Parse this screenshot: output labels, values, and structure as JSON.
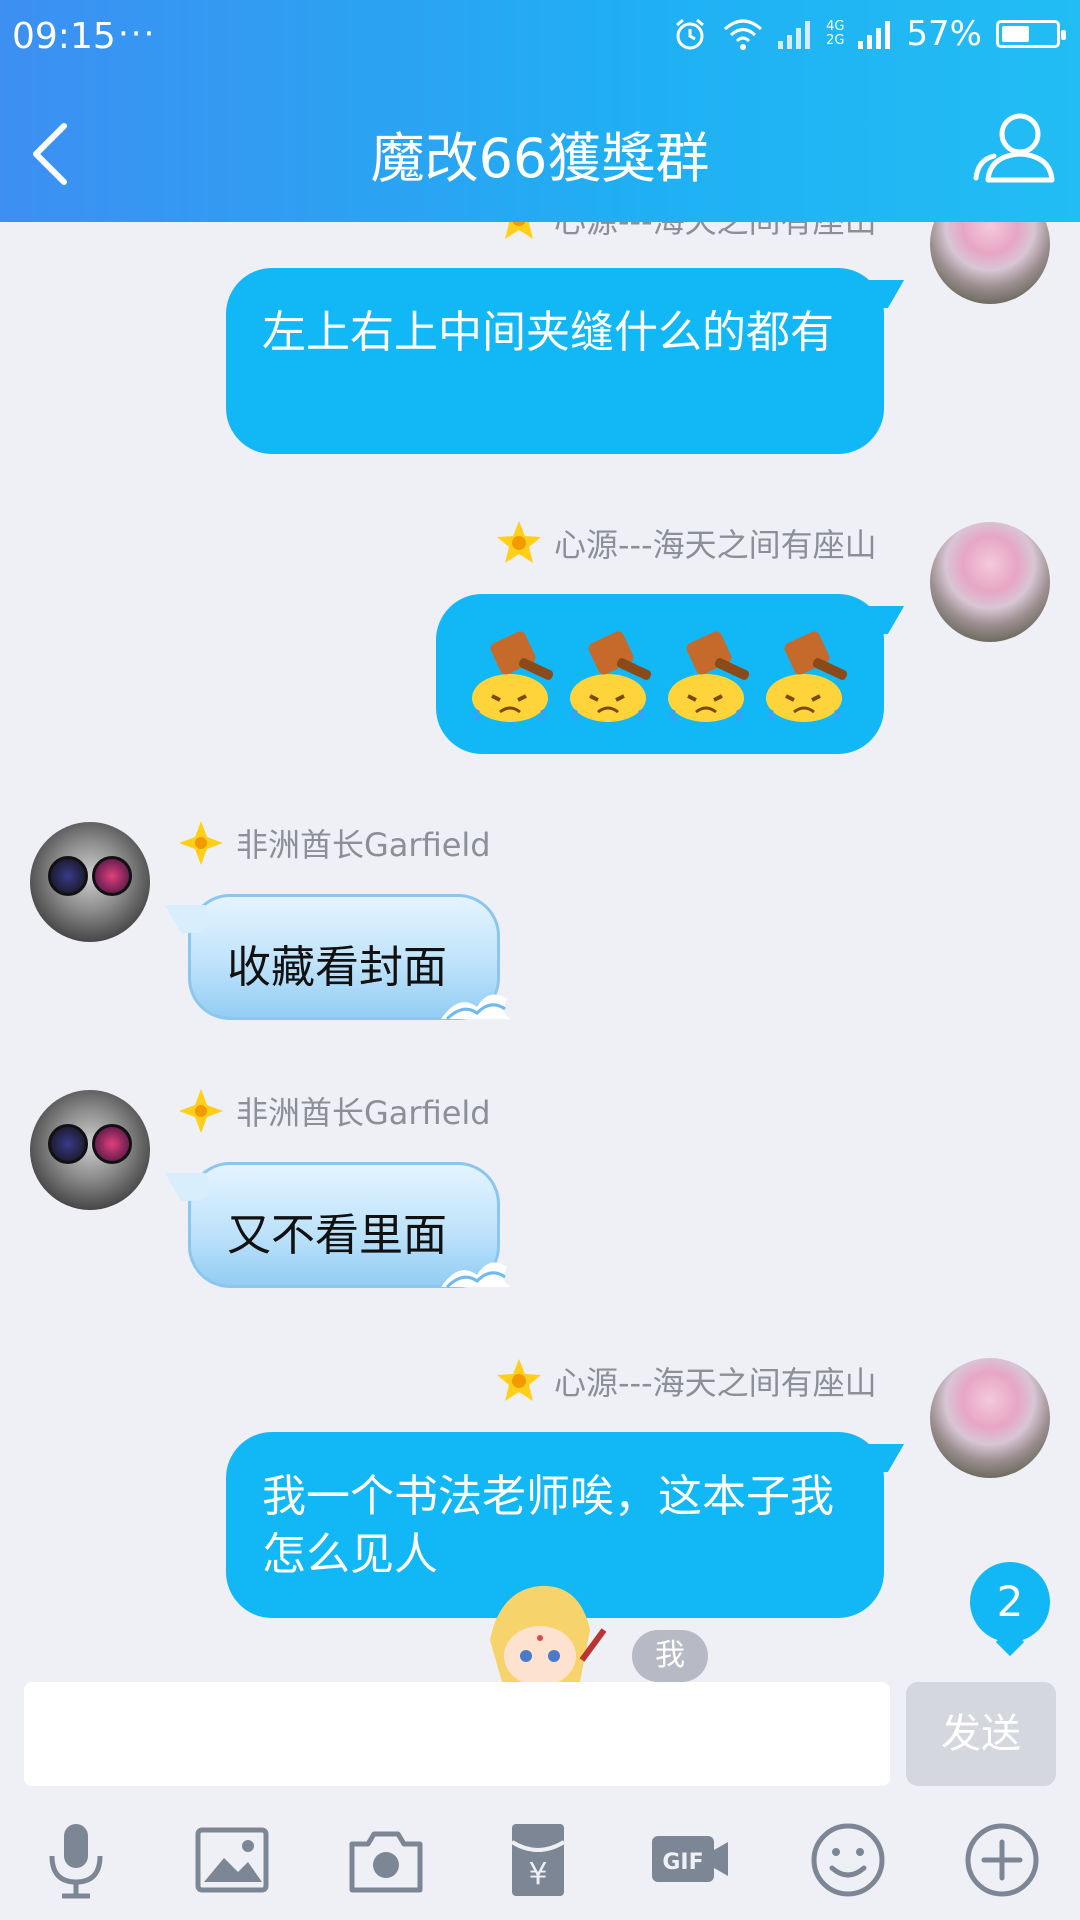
{
  "status_bar": {
    "time": "09:15",
    "dots": "···",
    "network_top": "4G",
    "network_bottom": "2G",
    "battery_text": "57%",
    "battery_level": 0.57
  },
  "header": {
    "title": "魔改66獲獎群"
  },
  "messages": [
    {
      "sender": "心源---海天之间有座山",
      "text": "左上右上中间夹缝什么的都有",
      "direction": "outgoing"
    },
    {
      "sender": "心源---海天之间有座山",
      "text": "",
      "emoji": [
        "hammer-cry-emoji",
        "hammer-cry-emoji",
        "hammer-cry-emoji",
        "hammer-cry-emoji"
      ],
      "direction": "outgoing"
    },
    {
      "sender": "非洲酋长Garfield",
      "text": "收藏看封面",
      "direction": "incoming"
    },
    {
      "sender": "非洲酋长Garfield",
      "text": "又不看里面",
      "direction": "incoming"
    },
    {
      "sender": "心源---海天之间有座山",
      "text": "我一个书法老师唉，这本子我怎么见人",
      "direction": "outgoing"
    }
  ],
  "unread_count": "2",
  "me_tag": "我",
  "input": {
    "value": "",
    "send_label": "发送"
  },
  "toolbar": [
    "mic-icon",
    "image-icon",
    "camera-icon",
    "red-packet-icon",
    "gif-icon",
    "emoji-icon",
    "plus-icon"
  ],
  "colors": {
    "header_start": "#3d8ff2",
    "header_end": "#22bdf5",
    "bubble_out": "#12b7f5",
    "background": "#eef0f6"
  }
}
